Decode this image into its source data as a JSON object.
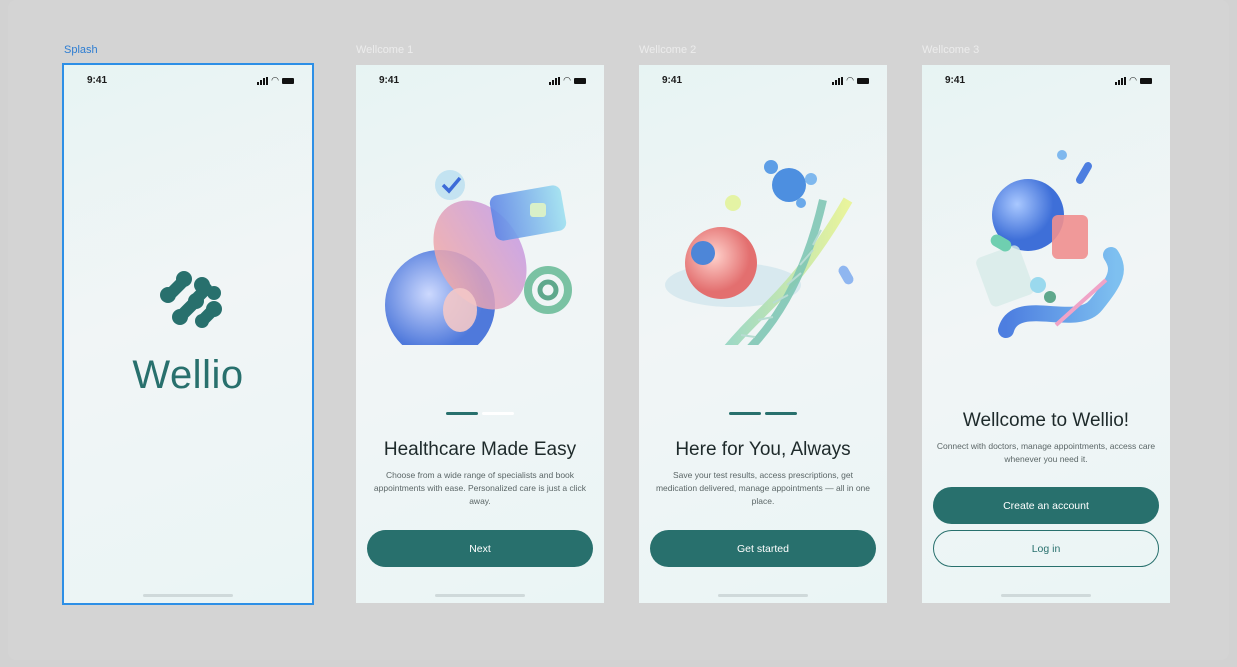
{
  "frames": [
    {
      "label": "Splash",
      "time": "9:41",
      "brand": "Wellio"
    },
    {
      "label": "Wellcome 1",
      "time": "9:41",
      "title": "Healthcare Made Easy",
      "body": "Choose from a wide range of specialists and book appointments with ease. Personalized care is just a click away.",
      "button": "Next",
      "page": 1,
      "pages": 2
    },
    {
      "label": "Wellcome 2",
      "time": "9:41",
      "title": "Here for You, Always",
      "body": "Save your test results, access prescriptions, get medication delivered, manage appointments — all in one place.",
      "button": "Get started",
      "page": 2,
      "pages": 2
    },
    {
      "label": "Wellcome 3",
      "time": "9:41",
      "title": "Wellcome to Wellio!",
      "body": "Connect with doctors, manage appointments,  access care whenever you need it.",
      "primary_button": "Create an account",
      "secondary_button": "Log in"
    }
  ],
  "colors": {
    "brand": "#28706d",
    "selection": "#2d8fe6",
    "canvas": "#d4d4d4"
  },
  "icons": [
    "signal-icon",
    "wifi-icon",
    "battery-icon",
    "wellio-logo-icon"
  ]
}
